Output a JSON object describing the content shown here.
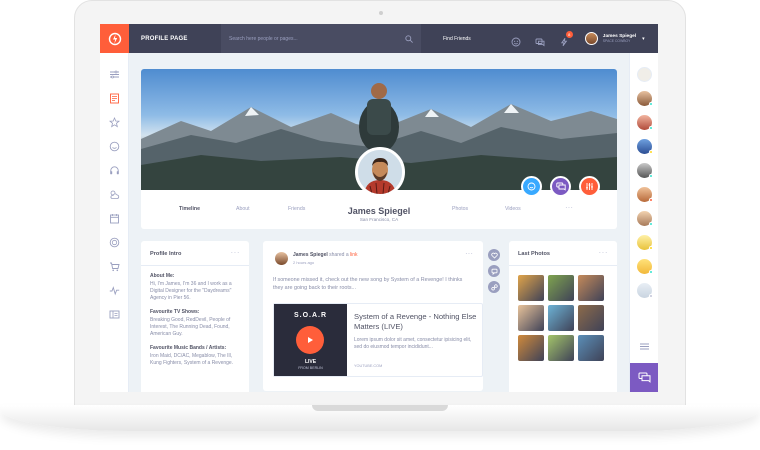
{
  "header": {
    "page_title": "PROFILE PAGE",
    "search_placeholder": "Search here people or pages...",
    "find_friends": "Find Friends",
    "notification_count": "8",
    "user_name": "James Spiegel",
    "user_status": "SPACE COWBOY"
  },
  "profile": {
    "name": "James Spiegel",
    "location": "San Francisco, CA",
    "nav": [
      "Timeline",
      "About",
      "Friends",
      "Photos",
      "Videos"
    ],
    "more": "···"
  },
  "intro": {
    "title": "Profile Intro",
    "more": "···",
    "about_me_label": "About Me:",
    "about_me": "Hi, I'm James, I'm 36 and I work as a Digital Designer for the \"Daydreams\" Agency in Pier 56.",
    "tv_label": "Favourite TV Shows:",
    "tv": "Breaking Good, RedDevil, People of Interest, The Running Dead, Found, American Guy.",
    "music_label": "Favourite Music Bands / Artists:",
    "music": "Iron Maid, DC/AC, Megablow, The Ill, Kung Fighters, System of a Revenge."
  },
  "post": {
    "author": "James Spiegel",
    "action": "shared a",
    "link_word": "link",
    "time": "2 hours ago",
    "more": "···",
    "text": "If someone missed it, check out the new song by System of a Revenge! I thinks they are going back to their roots...",
    "embed": {
      "thumb_title": "S.O.A.R",
      "thumb_live": "LIVE",
      "thumb_sub": "FROM BERLIN",
      "title": "System of a Revenge - Nothing Else Matters (LIVE)",
      "description": "Lorem ipsum dolor sit amet, consectetur ipisicing elit, sed do eiusmod tempor incididunt...",
      "source": "YOUTUBE.COM"
    }
  },
  "photos_widget": {
    "title": "Last Photos",
    "more": "···",
    "photo_colors": [
      "#e0a44a",
      "#7fa44f",
      "#c58a5a",
      "#e8c39a",
      "#6db3d6",
      "#8d6b4a",
      "#d08a3c",
      "#a4c56a",
      "#5b8fb8"
    ]
  },
  "colors": {
    "topbar": "#3f4257",
    "accent": "#ff5e3a",
    "cyan": "#38a9ff",
    "purple": "#7c5ac2"
  }
}
